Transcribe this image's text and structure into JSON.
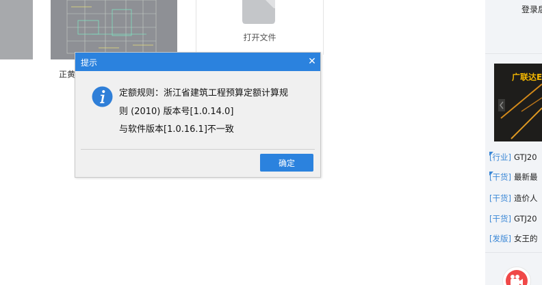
{
  "background": {
    "thumbnail_caption": "正黄",
    "open_file": {
      "label": "打开文件",
      "icon": "folder-icon"
    }
  },
  "right_panel": {
    "login_text": "登录后",
    "ad_banner": {
      "title": "广联达E"
    },
    "news": [
      {
        "tag": "[行业]",
        "title": "GTJ20",
        "marked": true
      },
      {
        "tag": "[干货]",
        "title": "最新最",
        "marked": true
      },
      {
        "tag": "[干货]",
        "title": "造价人",
        "marked": false
      },
      {
        "tag": "[干货]",
        "title": "GTJ20",
        "marked": false
      },
      {
        "tag": "[发版]",
        "title": "女王的",
        "marked": false
      }
    ],
    "video_icon": "video-camera-icon"
  },
  "dialog": {
    "title": "提示",
    "close_icon": "close-icon",
    "icon": "info-icon",
    "message_lines": [
      "定额规则：浙江省建筑工程预算定额计算规",
      "则 (2010) 版本号[1.0.14.0]",
      "与软件版本[1.0.16.1]不一致"
    ],
    "ok_label": "确定"
  },
  "colors": {
    "accent": "#2b82de",
    "dialog_bg": "#f0f0f0",
    "tag_blue": "#3a87d6",
    "banner_title": "#f5b800"
  }
}
